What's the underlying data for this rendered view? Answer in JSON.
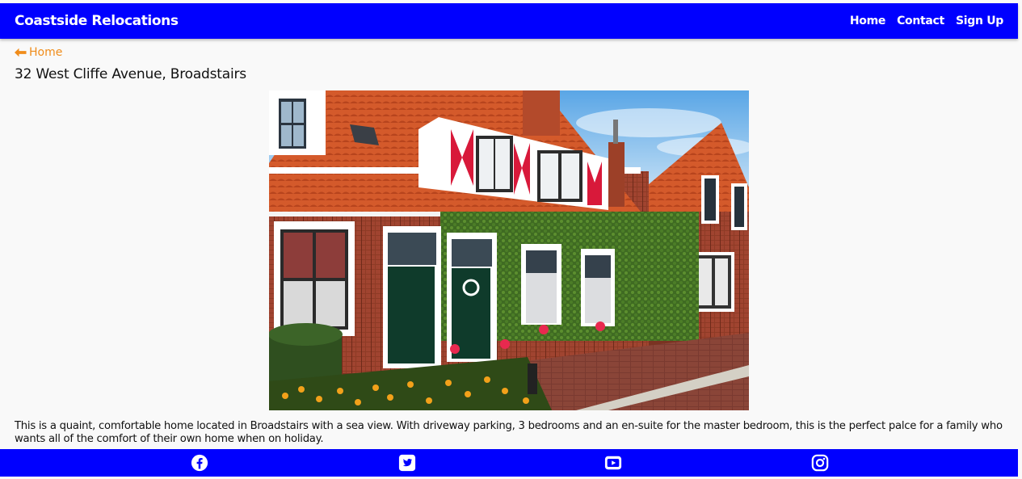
{
  "header": {
    "brand": "Coastside Relocations",
    "nav": [
      "Home",
      "Contact",
      "Sign Up"
    ]
  },
  "breadcrumb": {
    "back_label": "Home",
    "icon": "arrow-left-icon"
  },
  "property": {
    "title": "32 West Cliffe Avenue, Broadstairs",
    "description": "This is a quaint, comfortable home located in Broadstairs with a sea view. With driveway parking, 3 bedrooms and an en-suite for the master bedroom, this is the perfect palce for a family who wants all of the comfort of their own home when on holiday."
  },
  "footer": {
    "social_icons": [
      "facebook-icon",
      "twitter-icon",
      "youtube-icon",
      "instagram-icon"
    ]
  },
  "colors": {
    "brand_blue": "#0000ff",
    "link_orange": "#f08c1a",
    "background": "#f9f9f9"
  }
}
